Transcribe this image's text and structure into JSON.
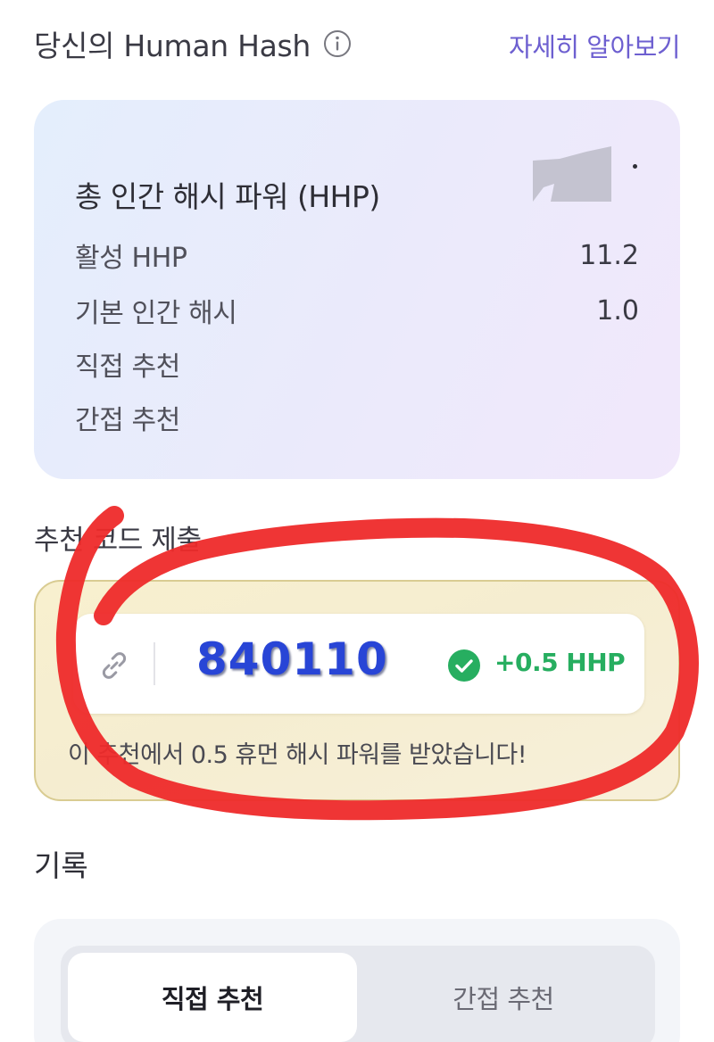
{
  "header": {
    "title": "당신의 Human Hash",
    "learn_more": "자세히 알아보기"
  },
  "hhp_card": {
    "title": "총 인간 해시 파워 (HHP)",
    "rows": [
      {
        "label": "활성 HHP",
        "value": "11.2"
      },
      {
        "label": "기본 인간 해시",
        "value": "1.0"
      },
      {
        "label": "직접 추천",
        "value": ""
      },
      {
        "label": "간접 추천",
        "value": ""
      }
    ]
  },
  "referral": {
    "heading": "추천 코드 제출",
    "code": "840110",
    "bonus": "+0.5 HHP",
    "message": "이 추천에서 0.5 휴먼 해시 파워를 받았습니다!"
  },
  "history": {
    "heading": "기록",
    "tabs": [
      {
        "label": "직접 추천",
        "active": true
      },
      {
        "label": "간접 추천",
        "active": false
      }
    ]
  },
  "colors": {
    "accent": "#6d5fd0",
    "code_blue": "#2845d6",
    "success_green": "#27ae60",
    "scribble_red": "#ee2a2a"
  },
  "icons": [
    "info-icon",
    "link-icon",
    "check-circle-icon"
  ]
}
